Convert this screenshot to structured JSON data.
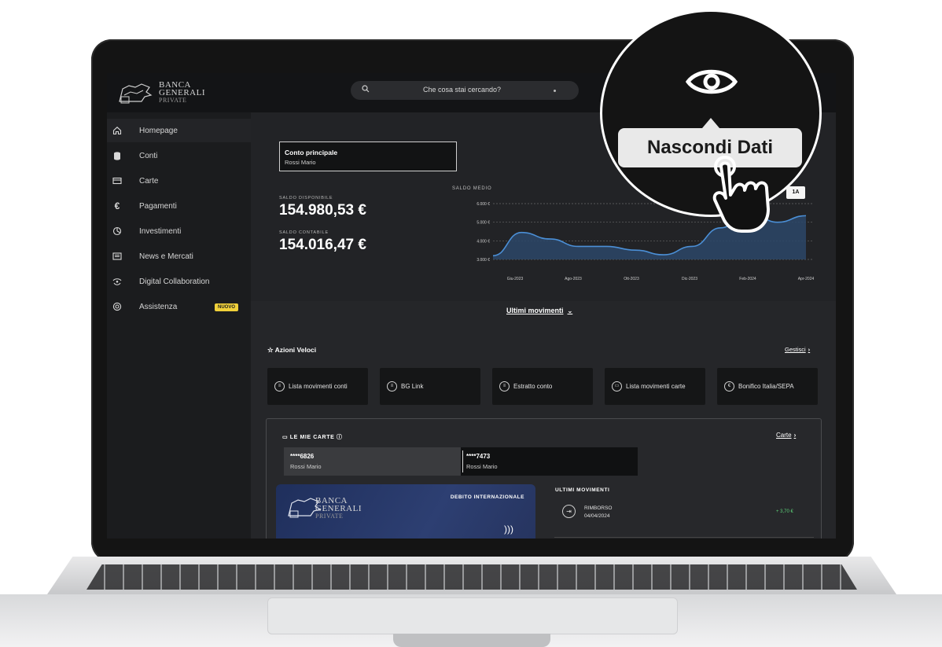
{
  "header": {
    "logo": {
      "line1": "BANCA",
      "line2": "GENERALI",
      "line3": "PRIVATE"
    },
    "search_placeholder": "Che cosa stai cercando?"
  },
  "sidebar": {
    "items": [
      {
        "label": "Homepage",
        "icon": "home-icon",
        "active": true
      },
      {
        "label": "Conti",
        "icon": "database-icon"
      },
      {
        "label": "Carte",
        "icon": "card-icon"
      },
      {
        "label": "Pagamenti",
        "icon": "euro-icon"
      },
      {
        "label": "Investimenti",
        "icon": "investment-icon"
      },
      {
        "label": "News e Mercati",
        "icon": "newspaper-icon"
      },
      {
        "label": "Digital Collaboration",
        "icon": "collaboration-icon"
      },
      {
        "label": "Assistenza",
        "icon": "support-icon",
        "badge": "NUOVO"
      }
    ]
  },
  "account": {
    "name": "Conto principale",
    "owner": "Rossi Mario",
    "saldo_disponibile_label": "SALDO DISPONIBILE",
    "saldo_disponibile": "154.980,53 €",
    "saldo_contabile_label": "SALDO CONTABILE",
    "saldo_contabile": "154.016,47 €"
  },
  "chart_data": {
    "type": "area",
    "title": "SALDO MEDIO",
    "x_tick_labels": [
      "Giu-2023",
      "Ago-2023",
      "Ott-2023",
      "Dic-2023",
      "Feb-2024",
      "Apr-2024"
    ],
    "y_tick_labels": [
      "6.000 €",
      "5.000 €",
      "4.000 €",
      "3.000 €"
    ],
    "ylim": [
      3000,
      6000
    ],
    "x": [
      "2023-05",
      "2023-06",
      "2023-07",
      "2023-08",
      "2023-09",
      "2023-10",
      "2023-11",
      "2023-12",
      "2024-01",
      "2024-02",
      "2024-03",
      "2024-04"
    ],
    "values": [
      3200,
      4450,
      4100,
      3700,
      3700,
      3500,
      3250,
      3700,
      4700,
      5550,
      5000,
      5350
    ],
    "grid": true,
    "range_badge": "1A",
    "line_color": "#4b8fd6"
  },
  "links": {
    "ultimi_movimenti": "Ultimi movimenti"
  },
  "quick_actions": {
    "title": "Azioni Veloci",
    "manage": "Gestisci",
    "items": [
      {
        "label": "Lista movimenti conti",
        "icon": "list-icon"
      },
      {
        "label": "BG Link",
        "icon": "link-icon"
      },
      {
        "label": "Estratto conto",
        "icon": "statement-icon"
      },
      {
        "label": "Lista movimenti carte",
        "icon": "card-icon"
      },
      {
        "label": "Bonifico Italia/SEPA",
        "icon": "euro-icon"
      }
    ]
  },
  "cards": {
    "title": "LE MIE CARTE",
    "link": "Carte",
    "list": [
      {
        "number": "****6826",
        "owner": "Rossi Mario",
        "selected": true
      },
      {
        "number": "****7473",
        "owner": "Rossi Mario"
      }
    ],
    "card_type": "DEBITO INTERNAZIONALE",
    "movements_title": "ULTIMI MOVIMENTI",
    "movements": [
      {
        "label": "RIMBORSO",
        "date": "04/04/2024",
        "amount": "+ 3,70 €"
      }
    ]
  },
  "overlay": {
    "tooltip": "Nascondi Dati",
    "icon": "eye-icon"
  },
  "colors": {
    "accent_badge": "#f0d03a",
    "positive": "#5dd37a",
    "background": "#1d1e20"
  }
}
